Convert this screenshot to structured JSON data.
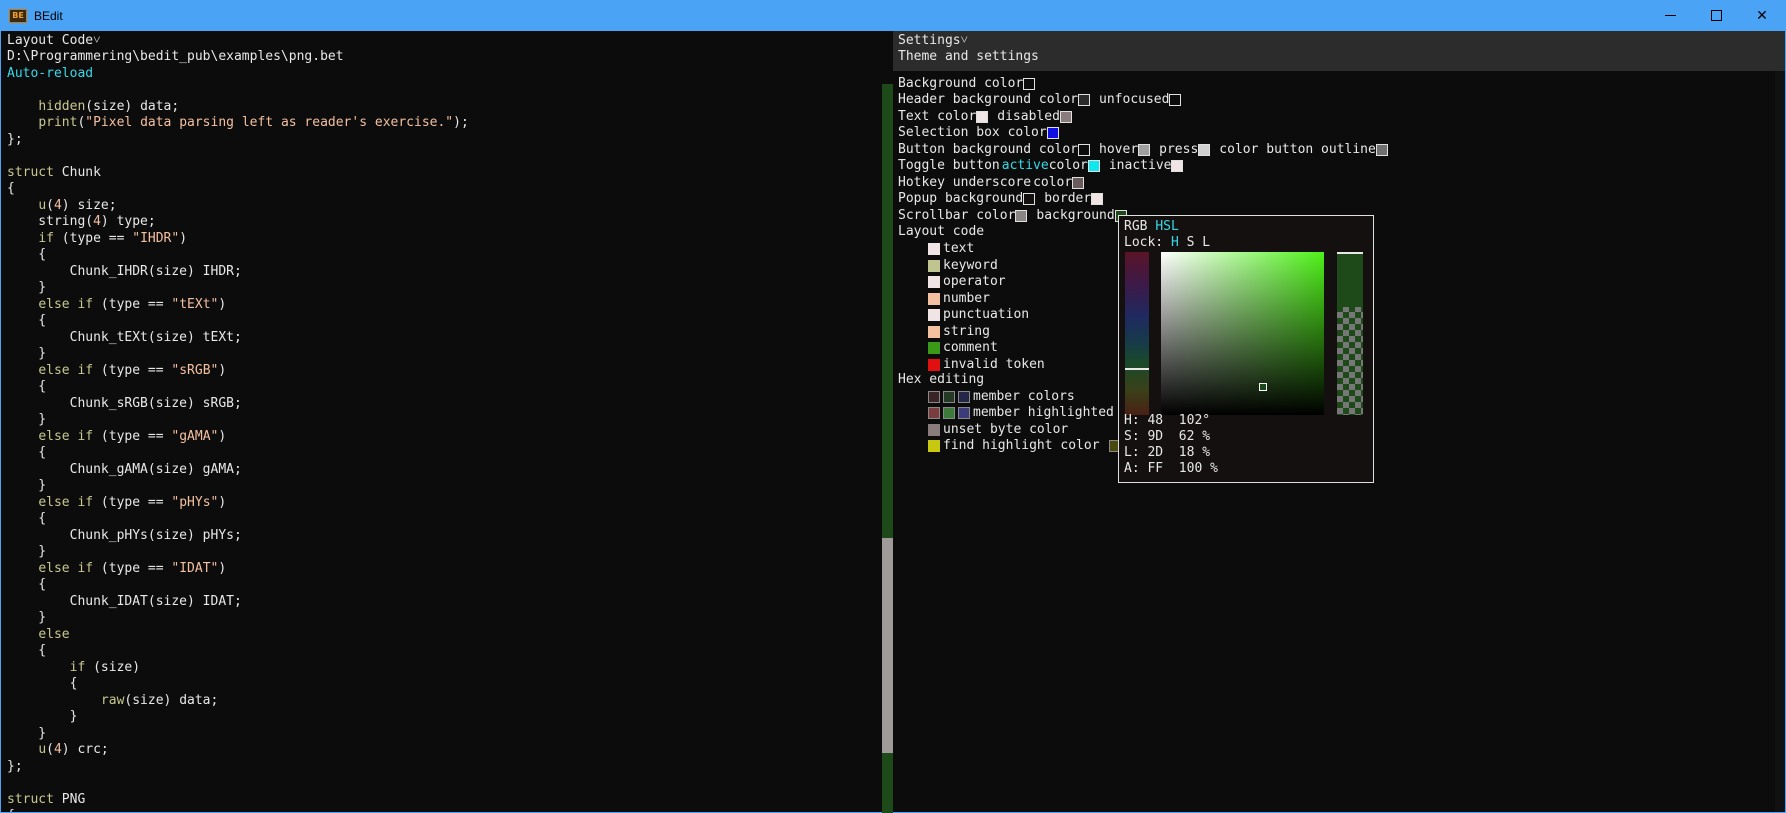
{
  "window": {
    "title": "BEdit",
    "icon_label": "BE",
    "minimize_icon": "minimize-icon",
    "maximize_icon": "maximize-icon",
    "close_icon": "close-icon"
  },
  "left": {
    "header": "Layout Code˅",
    "file_path": "D:\\Programmering\\bedit_pub\\examples\\png.bet",
    "auto_reload": "Auto-reload",
    "code_lines": [
      [
        [
          "t",
          "\t"
        ]
      ],
      [
        [
          "t",
          "    "
        ],
        [
          "k",
          "hidden"
        ],
        [
          "t",
          "(size) data;"
        ]
      ],
      [
        [
          "t",
          "    "
        ],
        [
          "k",
          "print"
        ],
        [
          "t",
          "("
        ],
        [
          "s",
          "\"Pixel data parsing left as reader's exercise.\""
        ],
        [
          "t",
          ");"
        ]
      ],
      [
        [
          "t",
          "};"
        ]
      ],
      [
        [
          "t",
          ""
        ]
      ],
      [
        [
          "k",
          "struct"
        ],
        [
          "t",
          " Chunk"
        ]
      ],
      [
        [
          "t",
          "{"
        ]
      ],
      [
        [
          "t",
          "    "
        ],
        [
          "k",
          "u"
        ],
        [
          "t",
          "("
        ],
        [
          "n",
          "4"
        ],
        [
          "t",
          ") size;"
        ]
      ],
      [
        [
          "t",
          "    string("
        ],
        [
          "n",
          "4"
        ],
        [
          "t",
          ") type;"
        ]
      ],
      [
        [
          "t",
          "    "
        ],
        [
          "k",
          "if"
        ],
        [
          "t",
          " (type == "
        ],
        [
          "s",
          "\"IHDR\""
        ],
        [
          "t",
          ")"
        ]
      ],
      [
        [
          "t",
          "    {"
        ]
      ],
      [
        [
          "t",
          "        Chunk_IHDR(size) IHDR;"
        ]
      ],
      [
        [
          "t",
          "    }"
        ]
      ],
      [
        [
          "t",
          "    "
        ],
        [
          "k",
          "else if"
        ],
        [
          "t",
          " (type == "
        ],
        [
          "s",
          "\"tEXt\""
        ],
        [
          "t",
          ")"
        ]
      ],
      [
        [
          "t",
          "    {"
        ]
      ],
      [
        [
          "t",
          "        Chunk_tEXt(size) tEXt;"
        ]
      ],
      [
        [
          "t",
          "    }"
        ]
      ],
      [
        [
          "t",
          "    "
        ],
        [
          "k",
          "else if"
        ],
        [
          "t",
          " (type == "
        ],
        [
          "s",
          "\"sRGB\""
        ],
        [
          "t",
          ")"
        ]
      ],
      [
        [
          "t",
          "    {"
        ]
      ],
      [
        [
          "t",
          "        Chunk_sRGB(size) sRGB;"
        ]
      ],
      [
        [
          "t",
          "    }"
        ]
      ],
      [
        [
          "t",
          "    "
        ],
        [
          "k",
          "else if"
        ],
        [
          "t",
          " (type == "
        ],
        [
          "s",
          "\"gAMA\""
        ],
        [
          "t",
          ")"
        ]
      ],
      [
        [
          "t",
          "    {"
        ]
      ],
      [
        [
          "t",
          "        Chunk_gAMA(size) gAMA;"
        ]
      ],
      [
        [
          "t",
          "    }"
        ]
      ],
      [
        [
          "t",
          "    "
        ],
        [
          "k",
          "else if"
        ],
        [
          "t",
          " (type == "
        ],
        [
          "s",
          "\"pHYs\""
        ],
        [
          "t",
          ")"
        ]
      ],
      [
        [
          "t",
          "    {"
        ]
      ],
      [
        [
          "t",
          "        Chunk_pHYs(size) pHYs;"
        ]
      ],
      [
        [
          "t",
          "    }"
        ]
      ],
      [
        [
          "t",
          "    "
        ],
        [
          "k",
          "else if"
        ],
        [
          "t",
          " (type == "
        ],
        [
          "s",
          "\"IDAT\""
        ],
        [
          "t",
          ")"
        ]
      ],
      [
        [
          "t",
          "    {"
        ]
      ],
      [
        [
          "t",
          "        Chunk_IDAT(size) IDAT;"
        ]
      ],
      [
        [
          "t",
          "    }"
        ]
      ],
      [
        [
          "t",
          "    "
        ],
        [
          "k",
          "else"
        ]
      ],
      [
        [
          "t",
          "    {"
        ]
      ],
      [
        [
          "t",
          "        "
        ],
        [
          "k",
          "if"
        ],
        [
          "t",
          " (size)"
        ]
      ],
      [
        [
          "t",
          "        {"
        ]
      ],
      [
        [
          "t",
          "            "
        ],
        [
          "k",
          "raw"
        ],
        [
          "t",
          "(size) data;"
        ]
      ],
      [
        [
          "t",
          "        }"
        ]
      ],
      [
        [
          "t",
          "    }"
        ]
      ],
      [
        [
          "t",
          "    "
        ],
        [
          "k",
          "u"
        ],
        [
          "t",
          "("
        ],
        [
          "n",
          "4"
        ],
        [
          "t",
          ") crc;"
        ]
      ],
      [
        [
          "t",
          "};"
        ]
      ],
      [
        [
          "t",
          ""
        ]
      ],
      [
        [
          "k",
          "struct"
        ],
        [
          "t",
          " PNG"
        ]
      ],
      [
        [
          "t",
          "{"
        ]
      ]
    ]
  },
  "settings": {
    "header": "Settings˅",
    "subtitle": "Theme and settings",
    "background_color": "Background color",
    "header_bg": "Header background color",
    "unfocused": "unfocused",
    "text_color": "Text color",
    "disabled": "disabled",
    "selection_box": "Selection box color",
    "button_bg": "Button background color",
    "hover": "hover",
    "press": "press",
    "color_button_outline": "color button outline",
    "toggle_button": "Toggle button",
    "active": "active",
    "color_word": "color",
    "inactive": "inactive",
    "hotkey_underscore": "Hotkey underscore",
    "popup_bg": "Popup background",
    "border": "border",
    "scrollbar_color": "Scrollbar color",
    "background_word": "background",
    "layout_code": "Layout code",
    "layout_items": [
      {
        "label": "text",
        "color": "#f0e4e4"
      },
      {
        "label": "keyword",
        "color": "#c0c490"
      },
      {
        "label": "operator",
        "color": "#f0e4e4"
      },
      {
        "label": "number",
        "color": "#f4c0a0"
      },
      {
        "label": "punctuation",
        "color": "#f0e4e4"
      },
      {
        "label": "string",
        "color": "#f4c0a0"
      },
      {
        "label": "comment",
        "color": "#3a9a18"
      },
      {
        "label": "invalid token",
        "color": "#e01010"
      }
    ],
    "hex_editing": "Hex editing",
    "member_colors": "member colors",
    "member_highlighted": "member highlighted",
    "unset_byte_color": "unset byte color",
    "find_highlight_color": "find highlight color",
    "colors": {
      "background": "#0c0c0c",
      "header_bg": "#2c2c2c",
      "unfocused": "#0c0c0c",
      "text": "#f0e4e4",
      "disabled": "#8a7c7c",
      "selection": "#1010e0",
      "button_bg": "#0c0c0c",
      "hover": "#a0a0a0",
      "press": "#d0d0d0",
      "outline": "#707070",
      "toggle_active": "#10e8f0",
      "toggle_inactive": "#f0e4e4",
      "hotkey": "#6a5c5c",
      "popup_bg": "#141010",
      "popup_border": "#f0e4e4",
      "scrollbar": "#8a8484",
      "scrollbar_bg": "#1e4a1a",
      "member1": "#3a2428",
      "member2": "#243a24",
      "member3": "#242848",
      "memberh1": "#7a3c3c",
      "memberh2": "#3c7a3c",
      "memberh3": "#3c3c7a",
      "unset_byte": "#8a7c7c",
      "find_highlight": "#c8c810",
      "find_highlight2": "#4a4a10"
    }
  },
  "picker": {
    "mode_rgb": "RGB",
    "mode_hsl": "HSL",
    "lock_label": "Lock:",
    "lock_h": "H",
    "lock_s": "S",
    "lock_l": "L",
    "h_row": "H: 48  102°",
    "s_row": "S: 9D  62 %",
    "l_row": "L: 2D  18 %",
    "a_row": "A: FF  100 %"
  }
}
